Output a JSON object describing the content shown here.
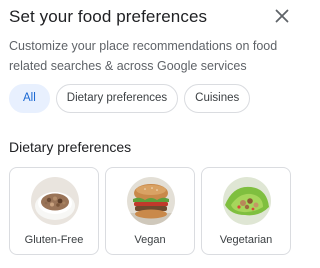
{
  "dialog": {
    "title": "Set your food preferences",
    "subtitle": "Customize your place recommendations on food related searches & across Google services",
    "close_icon": "close-icon"
  },
  "chips": [
    {
      "label": "All",
      "selected": true
    },
    {
      "label": "Dietary preferences",
      "selected": false
    },
    {
      "label": "Cuisines",
      "selected": false
    }
  ],
  "section": {
    "title": "Dietary preferences"
  },
  "cards": [
    {
      "label": "Gluten-Free",
      "image": "rice-bowl-photo"
    },
    {
      "label": "Vegan",
      "image": "veggie-burger-photo"
    },
    {
      "label": "Vegetarian",
      "image": "lettuce-wrap-photo"
    }
  ],
  "colors": {
    "selected_chip_bg": "#e8f0fe",
    "selected_chip_text": "#1967d2",
    "border": "#dadce0"
  }
}
